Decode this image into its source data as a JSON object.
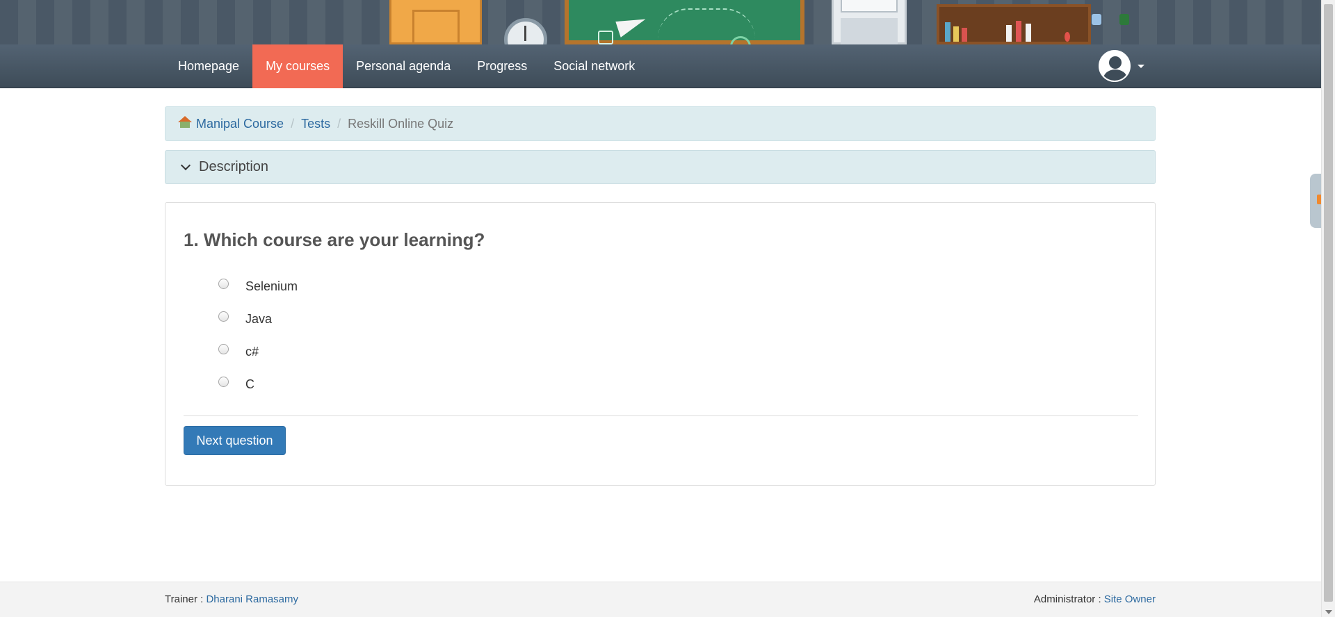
{
  "nav": {
    "items": [
      {
        "label": "Homepage",
        "active": false
      },
      {
        "label": "My courses",
        "active": true
      },
      {
        "label": "Personal agenda",
        "active": false
      },
      {
        "label": "Progress",
        "active": false
      },
      {
        "label": "Social network",
        "active": false
      }
    ]
  },
  "breadcrumb": {
    "course": "Manipal Course",
    "section": "Tests",
    "current": "Reskill Online Quiz"
  },
  "description": {
    "label": "Description"
  },
  "question": {
    "title": "1. Which course are your learning?",
    "options": [
      "Selenium",
      "Java",
      "c#",
      "C"
    ],
    "next_label": "Next question"
  },
  "footer": {
    "trainer_label": "Trainer :",
    "trainer_name": "Dharani Ramasamy",
    "admin_label": "Administrator :",
    "admin_name": "Site Owner"
  },
  "colors": {
    "navbar": "#3e4c58",
    "active_tab": "#f26a54",
    "link": "#2d6aa0",
    "primary_button": "#337ab7",
    "breadcrumb_bg": "#ddecef"
  },
  "icons": {
    "breadcrumb_home": "home-icon",
    "description_toggle": "chevron-down-icon",
    "user": "avatar-icon"
  }
}
